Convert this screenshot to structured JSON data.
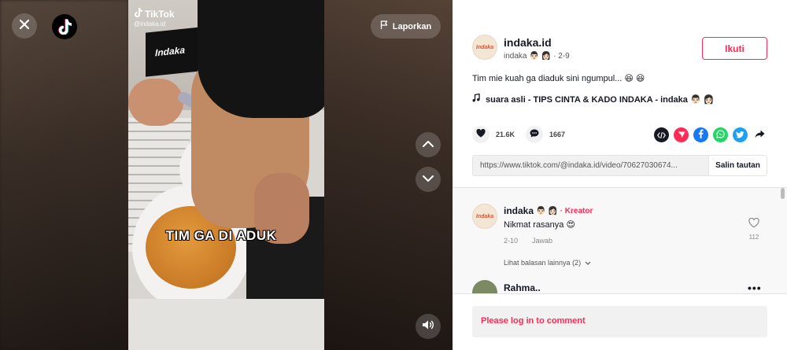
{
  "overlay": {
    "report_label": "Laporkan",
    "watermark_brand": "TikTok",
    "watermark_user": "@indaka.id",
    "video_caption": "TIM GA DI ADUK",
    "sign_text": "Indaka"
  },
  "post": {
    "avatar_text": "Indaka",
    "author": "indaka.id",
    "author_sub_name": "indaka",
    "author_sub_emoji": "👨🏻 👩🏻",
    "author_sub_date": "· 2-9",
    "follow_label": "Ikuti",
    "description": "Tim mie kuah ga diaduk sini ngumpul... 😆 😆",
    "music": "suara asli - TIPS CINTA & KADO INDAKA - indaka 👨🏻 👩🏻",
    "likes": "21.6K",
    "comments": "1667",
    "link": "https://www.tiktok.com/@indaka.id/video/70627030674...",
    "copy_label": "Salin tautan"
  },
  "comment_list": [
    {
      "author": "indaka",
      "emoji": "👨🏻 👩🏻",
      "badge": "· Kreator",
      "text": "Nikmat rasanya 😍",
      "date": "2-10",
      "reply_label": "Jawab",
      "like_count": "112",
      "more_replies": "Lihat balasan lainnya (2)"
    },
    {
      "author": "Rahma.."
    }
  ],
  "login_prompt": "Please log in to comment",
  "colors": {
    "accent": "#fe2c55",
    "facebook": "#1877f2",
    "whatsapp": "#25d366",
    "twitter": "#1da1f2",
    "embed": "#161823"
  }
}
